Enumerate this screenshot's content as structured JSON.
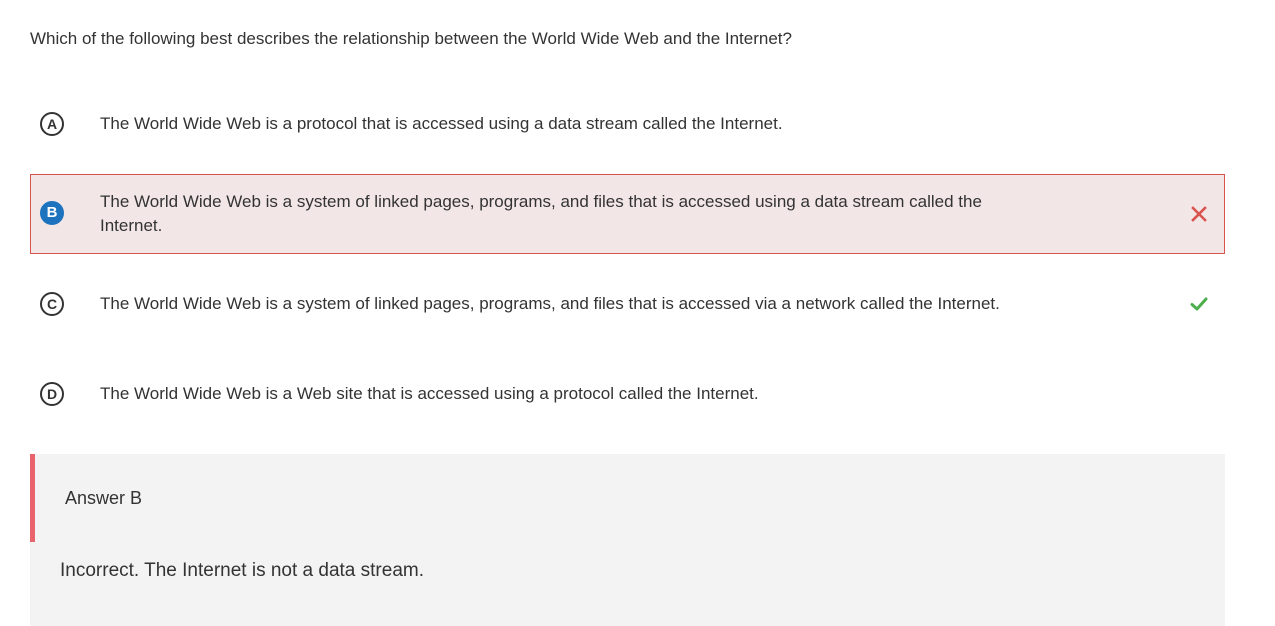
{
  "question": {
    "text": "Which of the following best describes the relationship between the World Wide Web and the Internet?"
  },
  "options": [
    {
      "letter": "A",
      "text": "The World Wide Web is a protocol that is accessed using a data stream called the Internet.",
      "selected": false,
      "status": "none"
    },
    {
      "letter": "B",
      "text": "The World Wide Web is a system of linked pages, programs, and files that is accessed using a data stream called the Internet.",
      "selected": true,
      "status": "incorrect",
      "mark_icon": "x-icon"
    },
    {
      "letter": "C",
      "text": "The World Wide Web is a system of linked pages, programs, and files that is accessed via a network called the Internet.",
      "selected": false,
      "status": "correct",
      "mark_icon": "checkmark-icon"
    },
    {
      "letter": "D",
      "text": "The World Wide Web is a Web site that is accessed using a protocol called the Internet.",
      "selected": false,
      "status": "none"
    }
  ],
  "feedback": {
    "answer_label": "Answer B",
    "explanation": "Incorrect. The Internet is not a data stream."
  },
  "colors": {
    "incorrect_accent": "#d9534f",
    "incorrect_background": "#f3e6e7",
    "selected_badge": "#1e73be",
    "correct_mark": "#4cae4c",
    "feedback_accent": "#e8636b",
    "feedback_background": "#f3f3f3"
  }
}
